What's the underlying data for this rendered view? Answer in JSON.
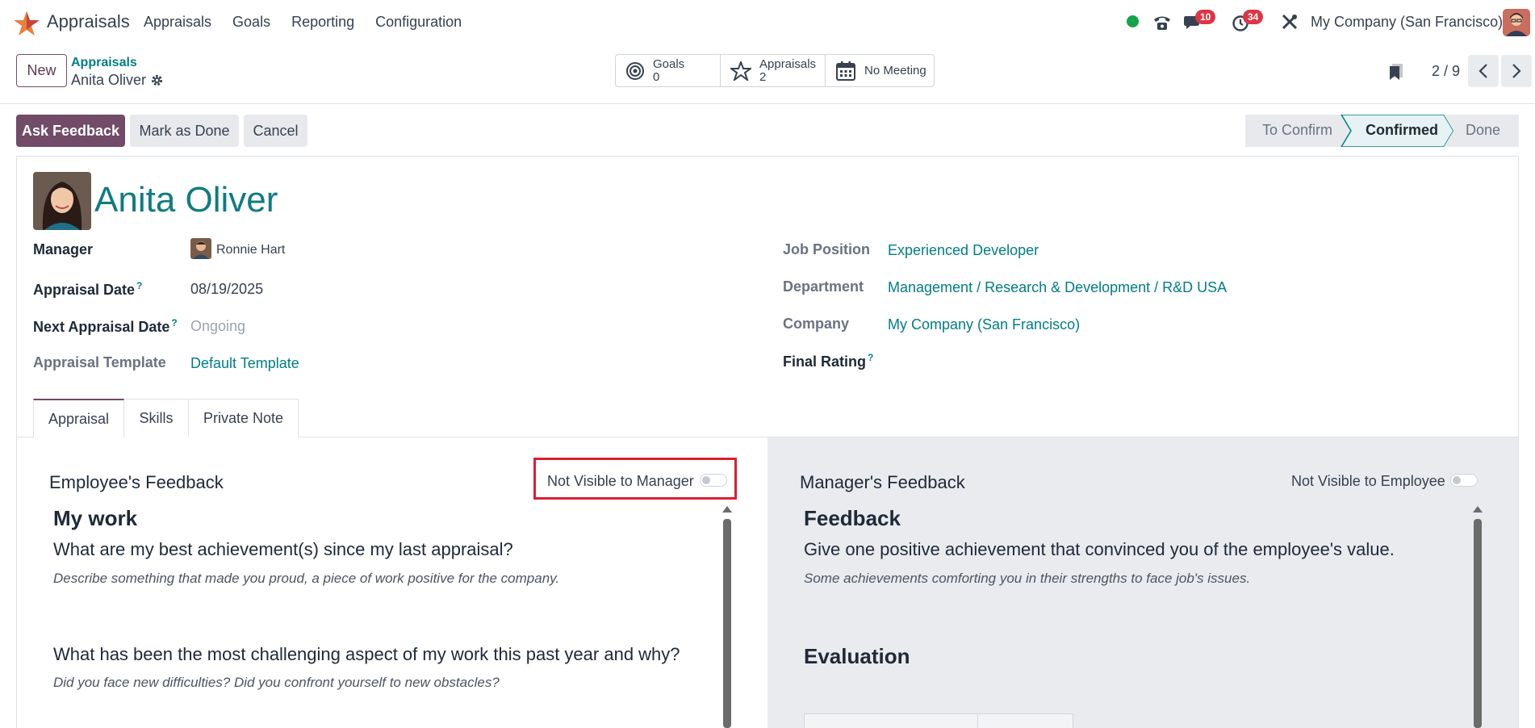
{
  "navbar": {
    "app_name": "Appraisals",
    "menu": [
      "Appraisals",
      "Goals",
      "Reporting",
      "Configuration"
    ],
    "messages_badge": "10",
    "activities_badge": "34",
    "company": "My Company (San Francisco)"
  },
  "control_panel": {
    "new_label": "New",
    "breadcrumb_parent": "Appraisals",
    "breadcrumb_current": "Anita Oliver",
    "smart_buttons": {
      "goals_label": "Goals",
      "goals_count": "0",
      "appraisals_label": "Appraisals",
      "appraisals_count": "2",
      "meeting_label": "No Meeting"
    },
    "pager": "2 / 9"
  },
  "actions": {
    "ask_feedback": "Ask Feedback",
    "mark_done": "Mark as Done",
    "cancel": "Cancel"
  },
  "statusbar": {
    "stages": [
      "To Confirm",
      "Confirmed",
      "Done"
    ],
    "current": "Confirmed"
  },
  "record": {
    "employee_name": "Anita Oliver",
    "left_fields": {
      "manager_label": "Manager",
      "manager_value": "Ronnie Hart",
      "appraisal_date_label": "Appraisal Date",
      "appraisal_date_value": "08/19/2025",
      "next_date_label": "Next Appraisal Date",
      "next_date_value": "Ongoing",
      "template_label": "Appraisal Template",
      "template_value": "Default Template"
    },
    "right_fields": {
      "job_label": "Job Position",
      "job_value": "Experienced Developer",
      "department_label": "Department",
      "department_value": "Management / Research & Development / R&D USA",
      "company_label": "Company",
      "company_value": "My Company (San Francisco)",
      "rating_label": "Final Rating",
      "rating_value": ""
    },
    "help_mark": "?"
  },
  "tabs": [
    "Appraisal",
    "Skills",
    "Private Note"
  ],
  "employee_feedback": {
    "title": "Employee's Feedback",
    "visibility_label": "Not Visible to Manager",
    "section": "My work",
    "q1": "What are my best achievement(s) since my last appraisal?",
    "q1_hint": "Describe something that made you proud, a piece of work positive for the company.",
    "q2": "What has been the most challenging aspect of my work this past year and why?",
    "q2_hint": "Did you face new difficulties? Did you confront yourself to new obstacles?"
  },
  "manager_feedback": {
    "title": "Manager's Feedback",
    "visibility_label": "Not Visible to Employee",
    "section": "Feedback",
    "q1": "Give one positive achievement that convinced you of the employee's value.",
    "q1_hint": "Some achievements comforting you in their strengths to face job's issues.",
    "section2": "Evaluation"
  }
}
